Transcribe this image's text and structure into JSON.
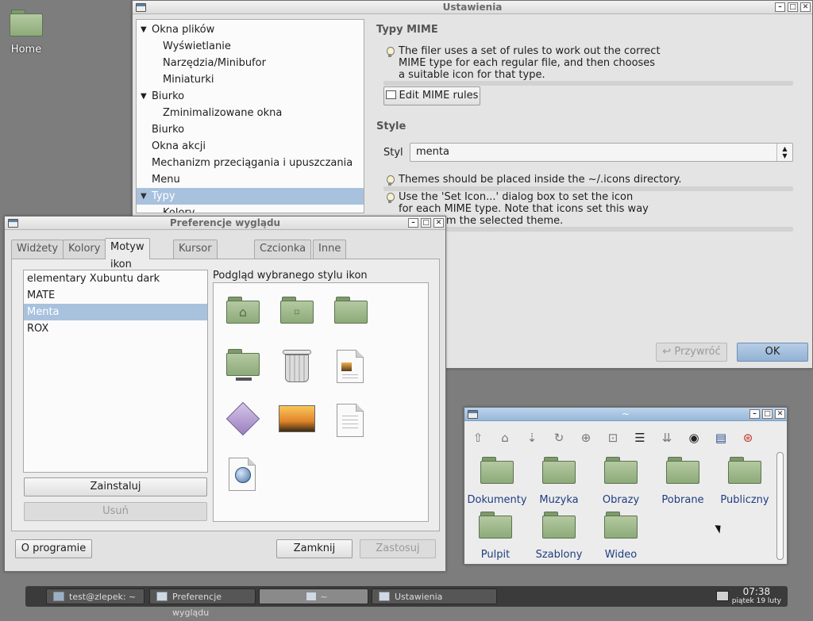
{
  "desktop": {
    "home_label": "Home"
  },
  "settings": {
    "title": "Ustawienia",
    "tree": [
      {
        "label": "Okna plików",
        "level": 0,
        "expander": "▼"
      },
      {
        "label": "Wyświetlanie",
        "level": 1
      },
      {
        "label": "Narzędzia/Minibufor",
        "level": 1
      },
      {
        "label": "Miniaturki",
        "level": 1
      },
      {
        "label": "Biurko",
        "level": 0,
        "expander": "▼"
      },
      {
        "label": "Zminimalizowane okna",
        "level": 1
      },
      {
        "label": "Biurko",
        "level": 0
      },
      {
        "label": "Okna akcji",
        "level": 0
      },
      {
        "label": "Mechanizm przeciągania i upuszczania",
        "level": 0
      },
      {
        "label": "Menu",
        "level": 0
      },
      {
        "label": "Typy",
        "level": 0,
        "expander": "▼",
        "selected": true
      },
      {
        "label": "Kolory",
        "level": 1
      }
    ],
    "mime_heading": "Typy MIME",
    "mime_info": [
      "The filer uses a set of rules to work out the correct",
      "MIME type for each regular file, and then chooses",
      "a suitable icon for that type."
    ],
    "edit_mime_button": "Edit MIME rules",
    "style_heading": "Style",
    "style_label": "Styl",
    "style_value": "menta",
    "themes_info": "Themes should be placed inside the ~/.icons directory.",
    "seticon_info": [
      "Use the 'Set Icon...' dialog box to set the icon",
      "for each MIME type. Note that icons set this way",
      "chose from the selected theme."
    ],
    "revert_button": "Przywróć",
    "ok_button": "OK"
  },
  "prefs": {
    "title": "Preferencje wyglądu",
    "tabs": [
      "Widżety",
      "Kolory",
      "Motyw ikon",
      "Kursor myszy",
      "Czcionka",
      "Inne"
    ],
    "active_tab": "Motyw ikon",
    "themes": [
      "elementary Xubuntu dark",
      "MATE",
      "Menta",
      "ROX"
    ],
    "selected_theme": "Menta",
    "preview_label": "Podgląd wybranego stylu ikon",
    "install_button": "Zainstaluj",
    "remove_button": "Usuń",
    "about_button": "O programie",
    "close_button": "Zamknij",
    "apply_button": "Zastosuj"
  },
  "filer": {
    "title": "~",
    "items": [
      "Dokumenty",
      "Muzyka",
      "Obrazy",
      "Pobrane",
      "Publiczny",
      "Pulpit",
      "Szablony",
      "Wideo"
    ]
  },
  "taskbar": {
    "tasks": [
      "test@zlepek: ~",
      "Preferencje wyglądu",
      "~",
      "Ustawienia"
    ],
    "time": "07:38",
    "date": "piątek 19 luty"
  }
}
